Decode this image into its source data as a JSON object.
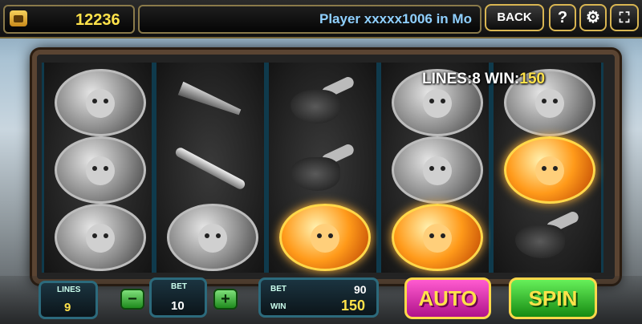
{
  "header": {
    "credits": "12236",
    "ticker": "Player xxxxx1006 in Mo",
    "back_label": "BACK",
    "help_label": "?",
    "settings_icon": "gear-icon",
    "fullscreen_icon": "fullscreen-icon"
  },
  "reels_info": {
    "lines_text": "LINES:8 WIN:",
    "win_value": "150"
  },
  "reels": [
    [
      "deity-girl",
      "horned-girl",
      "bull-demon"
    ],
    [
      "winged-sword",
      "trident-spear",
      "warrior-woman"
    ],
    [
      "roast-leg",
      "roast-leg",
      "golden-demon-child"
    ],
    [
      "horned-girl",
      "deity-boy",
      "golden-demon-child"
    ],
    [
      "winged-girl",
      "golden-demon-child",
      "roast-leg"
    ]
  ],
  "controls": {
    "lines_label": "LINES",
    "lines_value": "9",
    "bet_label": "BET",
    "bet_value": "10",
    "panel_bet_label": "BET",
    "panel_bet_value": "90",
    "panel_win_label": "WIN",
    "panel_win_value": "150",
    "auto_label": "AUTO",
    "spin_label": "SPIN",
    "minus_label": "−",
    "plus_label": "+"
  },
  "colors": {
    "accent_gold": "#ffe24a",
    "ticker_text": "#8fd0ff",
    "auto_button": "#d21aa0",
    "spin_button": "#2fbd26"
  }
}
